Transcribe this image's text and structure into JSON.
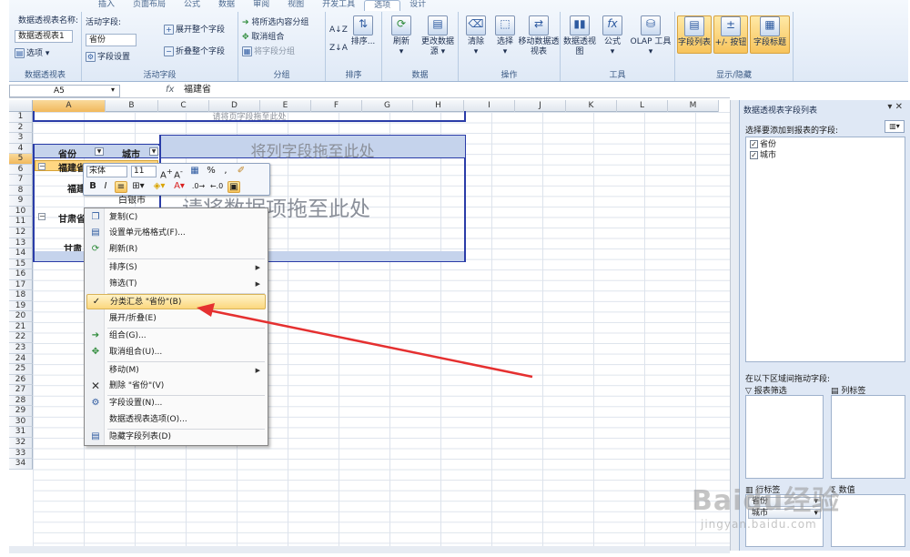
{
  "ribbon": {
    "tabs": [
      "插入",
      "页面布局",
      "公式",
      "数据",
      "审阅",
      "视图",
      "开发工具",
      "选项",
      "设计"
    ],
    "groups": {
      "pivot": {
        "label": "数据透视表",
        "name_caption": "数据透视表名称:",
        "name_value": "数据透视表1",
        "options_btn": "选项"
      },
      "active_field": {
        "label": "活动字段",
        "caption": "活动字段:",
        "value": "省份",
        "field_settings": "字段设置",
        "expand_all": "展开整个字段",
        "collapse_all": "折叠整个字段"
      },
      "group": {
        "label": "分组",
        "group_selection": "将所选内容分组",
        "ungroup": "取消组合",
        "group_field": "将字段分组"
      },
      "sort": {
        "label": "排序",
        "sort_btn": "排序..."
      },
      "data": {
        "label": "数据",
        "refresh": "刷新",
        "change_source": "更改数据源"
      },
      "actions": {
        "label": "操作",
        "clear": "清除",
        "select": "选择",
        "move": "移动数据透视表"
      },
      "tools": {
        "label": "工具",
        "pivot_chart": "数据透视图",
        "formulas": "公式",
        "olap": "OLAP 工具"
      },
      "show_hide": {
        "label": "显示/隐藏",
        "field_list": "字段列表",
        "buttons": "+/- 按钮",
        "headers": "字段标题"
      }
    }
  },
  "formula_bar": {
    "name_box": "A5",
    "fx": "fx",
    "value": "福建省"
  },
  "sheet": {
    "columns": [
      "A",
      "B",
      "C",
      "D",
      "E",
      "F",
      "G",
      "H",
      "I",
      "J",
      "K",
      "L",
      "M"
    ],
    "rows": [
      "1",
      "2",
      "3",
      "4",
      "5",
      "6",
      "7",
      "8",
      "9",
      "10",
      "11",
      "12",
      "13",
      "14",
      "15",
      "16",
      "17",
      "18",
      "19",
      "20",
      "21",
      "22",
      "23",
      "24",
      "25",
      "26",
      "27",
      "28",
      "29",
      "30",
      "31",
      "32",
      "33",
      "34"
    ],
    "pivot": {
      "page_drop": "请将页字段拖至此处",
      "col_drop": "将列字段拖至此处",
      "data_drop": "请将数据项拖至此处",
      "hdr_province": "省份",
      "hdr_city": "城市",
      "row_fujian": "福建省",
      "row_fujian_total": "福建",
      "row_gansu": "甘肃省",
      "row_gansu_total": "甘肃",
      "city_partial": "白银市"
    }
  },
  "mini_toolbar": {
    "font": "宋体",
    "size": "11",
    "bold": "B",
    "italic": "I"
  },
  "context_menu": {
    "items": [
      {
        "label": "复制(C)",
        "icon": "copy-icon"
      },
      {
        "label": "设置单元格格式(F)...",
        "icon": "format-cells-icon"
      },
      {
        "label": "刷新(R)",
        "icon": "refresh-icon"
      },
      {
        "label": "排序(S)",
        "icon": ""
      },
      {
        "label": "筛选(T)",
        "icon": ""
      },
      {
        "label": "分类汇总 \"省份\"(B)",
        "icon": "check-icon"
      },
      {
        "label": "展开/折叠(E)",
        "icon": ""
      },
      {
        "label": "组合(G)...",
        "icon": "group-icon"
      },
      {
        "label": "取消组合(U)...",
        "icon": "ungroup-icon"
      },
      {
        "label": "移动(M)",
        "icon": ""
      },
      {
        "label": "删除 \"省份\"(V)",
        "icon": "delete-icon"
      },
      {
        "label": "字段设置(N)...",
        "icon": "field-settings-icon"
      },
      {
        "label": "数据透视表选项(O)...",
        "icon": ""
      },
      {
        "label": "隐藏字段列表(D)",
        "icon": "field-list-icon"
      }
    ]
  },
  "task_pane": {
    "title": "数据透视表字段列表",
    "choose_label": "选择要添加到报表的字段:",
    "fields": [
      "省份",
      "城市"
    ],
    "drag_label": "在以下区域间拖动字段:",
    "report_filter": "报表筛选",
    "column_labels": "列标签",
    "row_labels": "行标签",
    "values": "数值",
    "row_items": [
      "省份",
      "城市"
    ]
  },
  "watermark": {
    "main": "Baidu经验",
    "sub": "jingyan.baidu.com"
  },
  "colors": {
    "accent": "#2a3ca8",
    "highlight": "#fbd77e",
    "arrow": "#e53030"
  }
}
